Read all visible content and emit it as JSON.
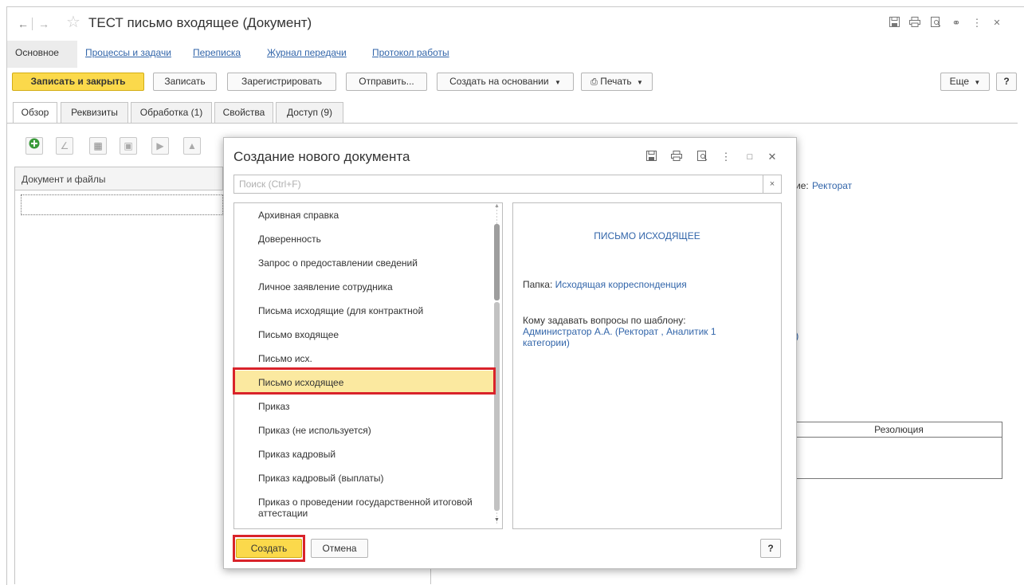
{
  "window": {
    "title": "ТЕСТ письмо входящее (Документ)"
  },
  "sections": [
    "Основное",
    "Процессы и задачи",
    "Переписка",
    "Журнал передачи",
    "Протокол работы"
  ],
  "toolbar": {
    "save_close": "Записать и закрыть",
    "save": "Записать",
    "register": "Зарегистрировать",
    "send": "Отправить...",
    "create_based": "Создать на основании",
    "print": "Печать",
    "more": "Еще",
    "help": "?"
  },
  "tabs": [
    "Обзор",
    "Реквизиты",
    "Обработка (1)",
    "Свойства",
    "Доступ (9)"
  ],
  "left_table": {
    "header": "Документ и файлы"
  },
  "right_fragments": {
    "dept_suffix": "ие: ",
    "dept_value": "Ректорат",
    "paren": ")",
    "resolution_header": "Резолюция"
  },
  "dialog": {
    "title": "Создание нового документа",
    "search_placeholder": "Поиск (Ctrl+F)",
    "search_clear": "×",
    "items": [
      "Архивная справка",
      "Доверенность",
      "Запрос о предоставлении сведений",
      "Личное заявление сотрудника",
      "Письма исходящие (для контрактной",
      "Письмо входящее",
      "Письмо исх.",
      "Письмо исходящее",
      "Приказ",
      "Приказ (не используется)",
      "Приказ кадровый",
      "Приказ кадровый (выплаты)",
      "Приказ о проведении государственной итоговой аттестации"
    ],
    "selected_index": 7,
    "preview": {
      "title": "ПИСЬМО ИСХОДЯЩЕЕ",
      "folder_label": "Папка: ",
      "folder_value": "Исходящая корреспонденция",
      "questions_label": "Кому задавать вопросы по шаблону:",
      "questions_value_1": "Администратор А.А. (Ректорат , Аналитик 1",
      "questions_value_2": "категории)"
    },
    "create_button": "Создать",
    "cancel_button": "Отмена",
    "help_button": "?"
  },
  "colors": {
    "accent_yellow": "#fbd94b",
    "highlight_red": "#d9232a",
    "link_blue": "#3366aa",
    "selection": "#fbe9a0"
  }
}
